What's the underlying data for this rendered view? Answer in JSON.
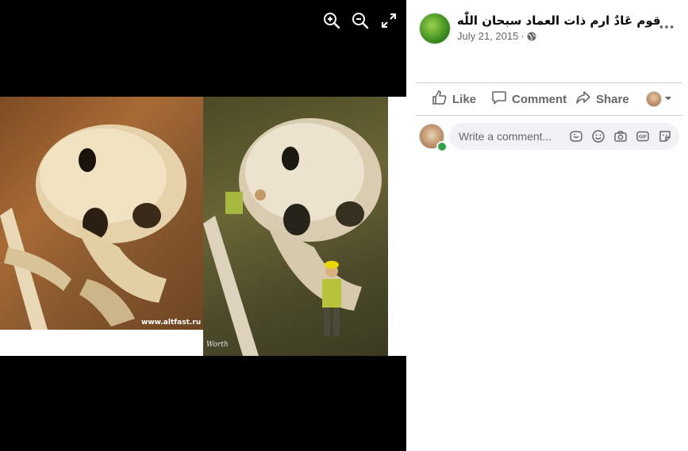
{
  "viewer": {
    "tools": [
      {
        "name": "zoom-in-icon"
      },
      {
        "name": "zoom-out-icon"
      },
      {
        "name": "fullscreen-icon"
      }
    ],
    "watermark_left": "www.altfast.ru",
    "watermark_right": "Worth"
  },
  "post": {
    "page_name": "قوم عَادٌ ارم ذات العماد سبحان اللّٰه",
    "date": "July 21, 2015",
    "separator": "·",
    "privacy_icon": "globe-icon"
  },
  "actions": {
    "like_label": "Like",
    "comment_label": "Comment",
    "share_label": "Share"
  },
  "comment_box": {
    "placeholder": "Write a comment..."
  },
  "colors": {
    "text_secondary": "#65676b",
    "online": "#31a24c",
    "input_bg": "#f0f2f5"
  }
}
